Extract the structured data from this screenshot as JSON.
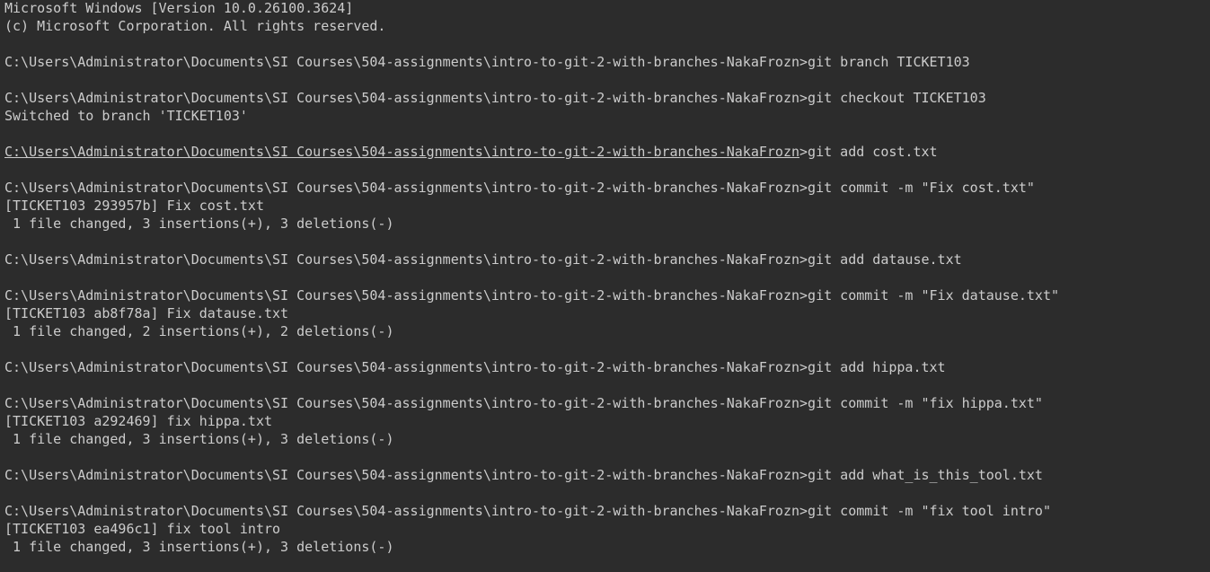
{
  "terminal": {
    "lines": [
      "Microsoft Windows [Version 10.0.26100.3624]",
      "(c) Microsoft Corporation. All rights reserved.",
      "",
      "C:\\Users\\Administrator\\Documents\\SI Courses\\504-assignments\\intro-to-git-2-with-branches-NakaFrozn>git branch TICKET103",
      "",
      "C:\\Users\\Administrator\\Documents\\SI Courses\\504-assignments\\intro-to-git-2-with-branches-NakaFrozn>git checkout TICKET103",
      "Switched to branch 'TICKET103'",
      "",
      "C:\\Users\\Administrator\\Documents\\SI Courses\\504-assignments\\intro-to-git-2-with-branches-NakaFrozn>git add cost.txt",
      "",
      "C:\\Users\\Administrator\\Documents\\SI Courses\\504-assignments\\intro-to-git-2-with-branches-NakaFrozn>git commit -m \"Fix cost.txt\"",
      "[TICKET103 293957b] Fix cost.txt",
      " 1 file changed, 3 insertions(+), 3 deletions(-)",
      "",
      "C:\\Users\\Administrator\\Documents\\SI Courses\\504-assignments\\intro-to-git-2-with-branches-NakaFrozn>git add datause.txt",
      "",
      "C:\\Users\\Administrator\\Documents\\SI Courses\\504-assignments\\intro-to-git-2-with-branches-NakaFrozn>git commit -m \"Fix datause.txt\"",
      "[TICKET103 ab8f78a] Fix datause.txt",
      " 1 file changed, 2 insertions(+), 2 deletions(-)",
      "",
      "C:\\Users\\Administrator\\Documents\\SI Courses\\504-assignments\\intro-to-git-2-with-branches-NakaFrozn>git add hippa.txt",
      "",
      "C:\\Users\\Administrator\\Documents\\SI Courses\\504-assignments\\intro-to-git-2-with-branches-NakaFrozn>git commit -m \"fix hippa.txt\"",
      "[TICKET103 a292469] fix hippa.txt",
      " 1 file changed, 3 insertions(+), 3 deletions(-)",
      "",
      "C:\\Users\\Administrator\\Documents\\SI Courses\\504-assignments\\intro-to-git-2-with-branches-NakaFrozn>git add what_is_this_tool.txt",
      "",
      "C:\\Users\\Administrator\\Documents\\SI Courses\\504-assignments\\intro-to-git-2-with-branches-NakaFrozn>git commit -m \"fix tool intro\"",
      "[TICKET103 ea496c1] fix tool intro",
      " 1 file changed, 3 insertions(+), 3 deletions(-)"
    ],
    "underlined_path": "C:\\Users\\Administrator\\Documents\\SI Courses\\504-assignments\\intro-to-git-2-with-branches-NakaFrozn",
    "underlined_command": ">git add cost.txt",
    "colors": {
      "background": "#2c2c2c",
      "text": "#cccccc"
    }
  }
}
